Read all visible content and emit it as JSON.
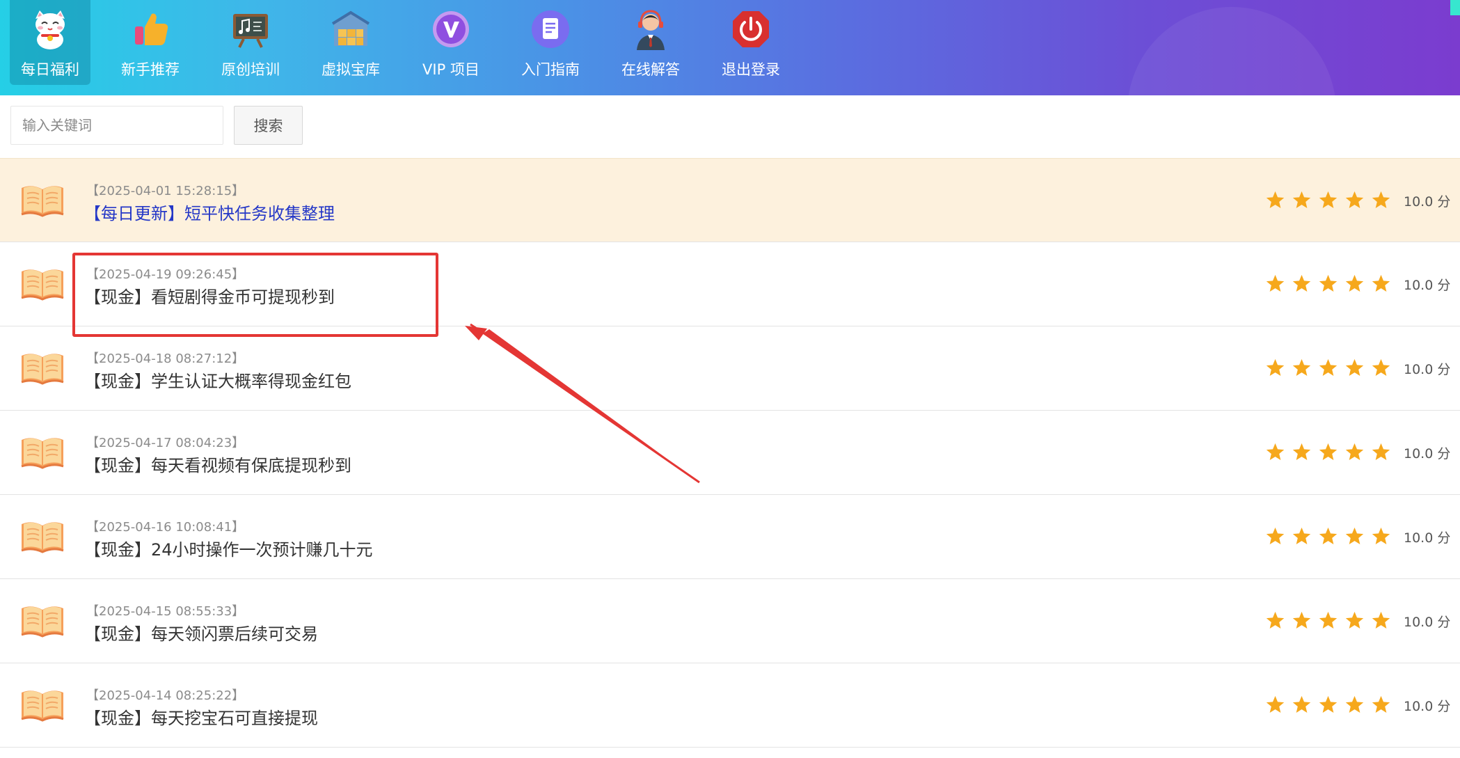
{
  "nav": {
    "items": [
      {
        "label": "每日福利",
        "icon": "lucky-cat-icon"
      },
      {
        "label": "新手推荐",
        "icon": "thumbs-up-icon"
      },
      {
        "label": "原创培训",
        "icon": "chalkboard-icon"
      },
      {
        "label": "虚拟宝库",
        "icon": "treasure-warehouse-icon"
      },
      {
        "label": "VIP 项目",
        "icon": "vip-badge-icon"
      },
      {
        "label": "入门指南",
        "icon": "document-icon"
      },
      {
        "label": "在线解答",
        "icon": "customer-service-icon"
      },
      {
        "label": "退出登录",
        "icon": "power-icon"
      }
    ],
    "active_index": 0
  },
  "search": {
    "placeholder": "输入关键词",
    "value": "",
    "button_label": "搜索"
  },
  "articles": [
    {
      "time": "【2025-04-01 15:28:15】",
      "title": "【每日更新】短平快任务收集整理",
      "rating": 5,
      "score": "10.0 分",
      "highlighted": true
    },
    {
      "time": "【2025-04-19 09:26:45】",
      "title": "【现金】看短剧得金币可提现秒到",
      "rating": 5,
      "score": "10.0 分"
    },
    {
      "time": "【2025-04-18 08:27:12】",
      "title": "【现金】学生认证大概率得现金红包",
      "rating": 5,
      "score": "10.0 分"
    },
    {
      "time": "【2025-04-17 08:04:23】",
      "title": "【现金】每天看视频有保底提现秒到",
      "rating": 5,
      "score": "10.0 分"
    },
    {
      "time": "【2025-04-16 10:08:41】",
      "title": "【现金】24小时操作一次预计赚几十元",
      "rating": 5,
      "score": "10.0 分"
    },
    {
      "time": "【2025-04-15 08:55:33】",
      "title": "【现金】每天领闪票后续可交易",
      "rating": 5,
      "score": "10.0 分"
    },
    {
      "time": "【2025-04-14 08:25:22】",
      "title": "【现金】每天挖宝石可直接提现",
      "rating": 5,
      "score": "10.0 分"
    }
  ],
  "colors": {
    "star": "#f6a81c",
    "highlight_row": "#fdf1dd",
    "highlight_title": "#2538c7",
    "annotation": "#e43634"
  },
  "annotation": {
    "target_article_index": 1
  }
}
